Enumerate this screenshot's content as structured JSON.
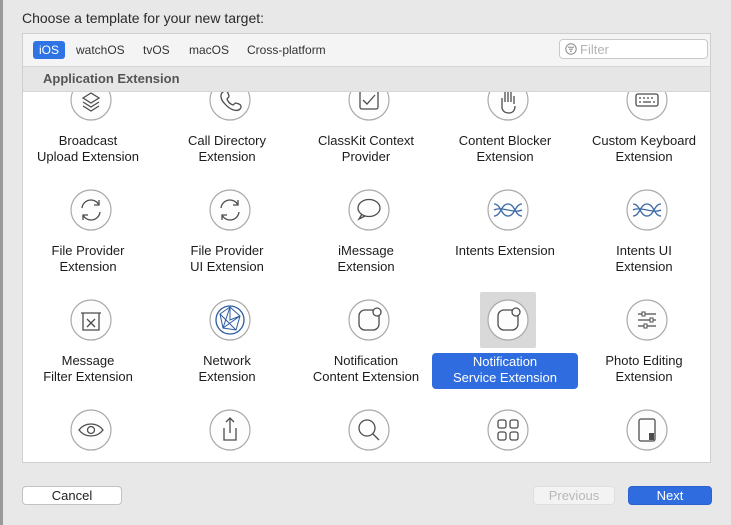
{
  "dialog": {
    "heading": "Choose a template for your new target:"
  },
  "tabs": [
    {
      "label": "iOS",
      "active": true
    },
    {
      "label": "watchOS"
    },
    {
      "label": "tvOS"
    },
    {
      "label": "macOS"
    },
    {
      "label": "Cross-platform"
    }
  ],
  "filter": {
    "placeholder": "Filter",
    "value": ""
  },
  "section": {
    "title": "Application Extension"
  },
  "templates": [
    {
      "icon": "layers-icon",
      "lines": [
        "Broadcast",
        "Upload Extension"
      ]
    },
    {
      "icon": "phone-icon",
      "lines": [
        "Call Directory",
        "Extension"
      ]
    },
    {
      "icon": "checkbox-icon",
      "lines": [
        "ClassKit Context",
        "Provider"
      ]
    },
    {
      "icon": "hand-icon",
      "lines": [
        "Content Blocker",
        "Extension"
      ]
    },
    {
      "icon": "keyboard-icon",
      "lines": [
        "Custom Keyboard",
        "Extension"
      ]
    },
    {
      "icon": "sync-arrows-icon",
      "lines": [
        "File Provider",
        "Extension"
      ]
    },
    {
      "icon": "sync-arrows-icon",
      "lines": [
        "File Provider",
        "UI Extension"
      ]
    },
    {
      "icon": "speech-bubble-icon",
      "lines": [
        "iMessage",
        "Extension"
      ]
    },
    {
      "icon": "waves-icon",
      "lines": [
        "Intents Extension"
      ]
    },
    {
      "icon": "waves-icon",
      "lines": [
        "Intents UI",
        "Extension"
      ]
    },
    {
      "icon": "filter-tray-icon",
      "lines": [
        "Message",
        "Filter Extension"
      ]
    },
    {
      "icon": "globe-network-icon",
      "lines": [
        "Network",
        "Extension"
      ]
    },
    {
      "icon": "notification-icon",
      "lines": [
        "Notification",
        "Content Extension"
      ]
    },
    {
      "icon": "notification-icon",
      "lines": [
        "Notification",
        "Service Extension"
      ],
      "selected": true
    },
    {
      "icon": "sliders-icon",
      "lines": [
        "Photo Editing",
        "Extension"
      ]
    },
    {
      "icon": "eye-icon",
      "lines": []
    },
    {
      "icon": "share-icon",
      "lines": []
    },
    {
      "icon": "magnifier-icon",
      "lines": []
    },
    {
      "icon": "grid-icon",
      "lines": []
    },
    {
      "icon": "document-icon",
      "lines": []
    }
  ],
  "buttons": {
    "cancel": "Cancel",
    "previous": "Previous",
    "next": "Next"
  }
}
